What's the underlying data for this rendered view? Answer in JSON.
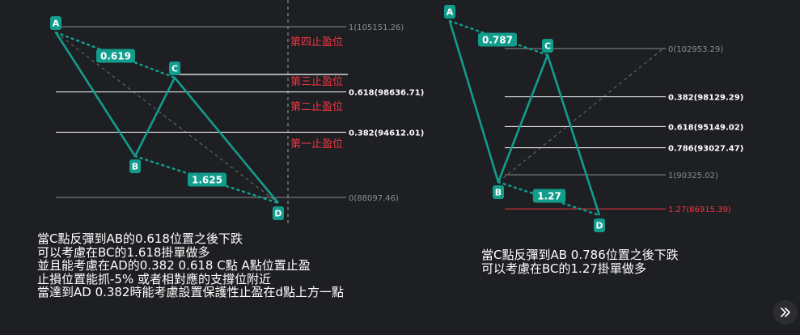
{
  "colors": {
    "background": "#1e1f22",
    "pattern": "#129c8c",
    "fib_white": "#ffffff",
    "fib_grey": "#8a8d93",
    "target_red": "#f23645",
    "label_white": "#ffffff",
    "diag_grey": "#6b6f78",
    "vline_grey": "#9aa0a8"
  },
  "chart_data": [
    {
      "type": "diagram",
      "pattern": "ABCD",
      "points": [
        "A",
        "B",
        "C",
        "D"
      ],
      "ratios": {
        "BC_over_AB": "0.619",
        "CD_over_BC": "1.625"
      },
      "fib_levels": [
        {
          "ratio": "1",
          "price": 105151.26,
          "label": "1(105151.26)"
        },
        {
          "ratio": "0.618",
          "price": 98636.71,
          "label": "0.618(98636.71)"
        },
        {
          "ratio": "0.382",
          "price": 94612.01,
          "label": "0.382(94612.01)"
        },
        {
          "ratio": "0",
          "price": 88097.46,
          "label": "0(88097.46)"
        }
      ],
      "targets": [
        "第四止盈位",
        "第三止盈位",
        "第二止盈位",
        "第一止盈位"
      ]
    },
    {
      "type": "diagram",
      "pattern": "ABCD",
      "points": [
        "A",
        "B",
        "C",
        "D"
      ],
      "ratios": {
        "BC_over_AB": "0.787",
        "CD_over_BC": "1.27"
      },
      "fib_levels": [
        {
          "ratio": "0",
          "price": 102953.29,
          "label": "0(102953.29)"
        },
        {
          "ratio": "0.382",
          "price": 98129.29,
          "label": "0.382(98129.29)"
        },
        {
          "ratio": "0.618",
          "price": 95149.02,
          "label": "0.618(95149.02)"
        },
        {
          "ratio": "0.786",
          "price": 93027.47,
          "label": "0.786(93027.47)"
        },
        {
          "ratio": "1",
          "price": 90325.02,
          "label": "1(90325.02)"
        },
        {
          "ratio": "1.27",
          "price": 86915.39,
          "label": "1.27(86915.39)"
        }
      ]
    }
  ],
  "notes": {
    "left": "當C點反彈到AB的0.618位置之後下跌\n可以考慮在BC的1.618掛單做多\n並且能考慮在AD的0.382 0.618 C點 A點位置止盈\n止損位置能抓-5% 或者相對應的支撐位附近\n當達到AD 0.382時能考慮設置保護性止盈在d點上方一點",
    "right": "當C點反彈到AB 0.786位置之後下跌\n可以考慮在BC的1.27掛單做多"
  },
  "nav": {
    "icon": "chevrons-right-icon",
    "glyph": "»"
  }
}
